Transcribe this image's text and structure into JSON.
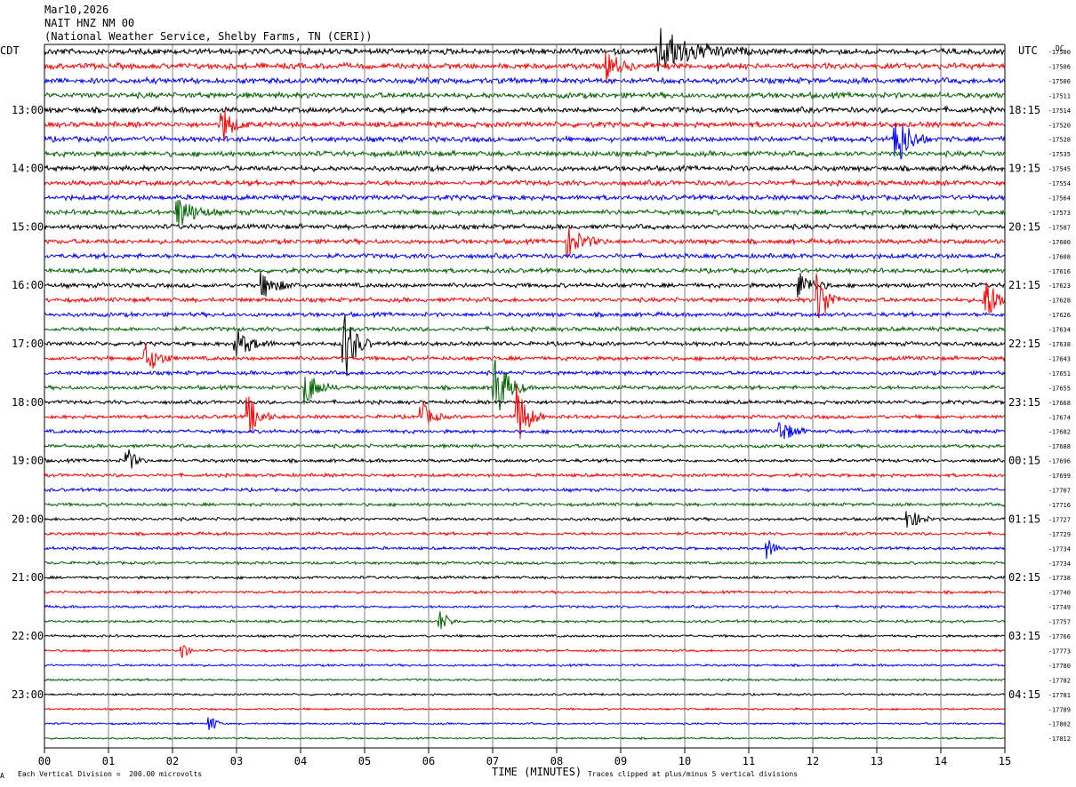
{
  "header": {
    "date": "Mar10,2026",
    "station": "NAIT HNZ NM 00",
    "location": "(National Weather Service, Shelby Farms, TN (CERI))"
  },
  "left_zone": "CDT",
  "right_zone": "UTC",
  "right_unit": "DC",
  "footer": {
    "scale_note": "Each Vertical Division =  200.00 microvolts",
    "clip_note": "Traces clipped at plus/minus 5 vertical divisions",
    "corner_mark": "A"
  },
  "colors": {
    "palette": [
      "#000000",
      "#ff0000",
      "#0000ff",
      "#006400"
    ],
    "grid": "#808080"
  },
  "chart_data": {
    "type": "helicorder",
    "xlabel": "TIME (MINUTES)",
    "x_ticks": [
      "00",
      "01",
      "02",
      "03",
      "04",
      "05",
      "06",
      "07",
      "08",
      "09",
      "10",
      "11",
      "12",
      "13",
      "14",
      "15"
    ],
    "xlim": [
      0,
      15
    ],
    "left_time_labels": [
      "13:00",
      "14:00",
      "15:00",
      "16:00",
      "17:00",
      "18:00",
      "19:00",
      "20:00",
      "21:00",
      "22:00",
      "23:00"
    ],
    "right_time_labels": [
      "18:15",
      "19:15",
      "20:15",
      "21:15",
      "22:15",
      "23:15",
      "00:15",
      "01:15",
      "02:15",
      "03:15",
      "04:15"
    ],
    "trace_offsets": [
      -17500,
      -17506,
      -17506,
      -17511,
      -17514,
      -17520,
      -17528,
      -17535,
      -17545,
      -17554,
      -17564,
      -17573,
      -17587,
      -17600,
      -17608,
      -17616,
      -17623,
      -17628,
      -17626,
      -17634,
      -17638,
      -17643,
      -17651,
      -17655,
      -17668,
      -17674,
      -17682,
      -17688,
      -17696,
      -17699,
      -17707,
      -17716,
      -17727,
      -17729,
      -17734,
      -17734,
      -17738,
      -17740,
      -17749,
      -17757,
      -17766,
      -17773,
      -17780,
      -17782,
      -17781,
      -17789,
      -17802,
      -17812
    ],
    "events": [
      {
        "trace": 0,
        "minute": 9.6,
        "amp": 1.6,
        "dur": 1.4
      },
      {
        "trace": 1,
        "minute": 8.8,
        "amp": 1.0,
        "dur": 0.5
      },
      {
        "trace": 5,
        "minute": 2.8,
        "amp": 1.2,
        "dur": 0.4
      },
      {
        "trace": 6,
        "minute": 13.3,
        "amp": 2.2,
        "dur": 0.5
      },
      {
        "trace": 11,
        "minute": 2.1,
        "amp": 1.2,
        "dur": 0.6
      },
      {
        "trace": 13,
        "minute": 8.2,
        "amp": 1.0,
        "dur": 0.6
      },
      {
        "trace": 16,
        "minute": 3.4,
        "amp": 0.9,
        "dur": 0.6
      },
      {
        "trace": 16,
        "minute": 11.8,
        "amp": 0.9,
        "dur": 0.5
      },
      {
        "trace": 17,
        "minute": 12.1,
        "amp": 1.8,
        "dur": 0.4
      },
      {
        "trace": 17,
        "minute": 14.7,
        "amp": 1.6,
        "dur": 0.5
      },
      {
        "trace": 20,
        "minute": 3.0,
        "amp": 1.0,
        "dur": 0.6
      },
      {
        "trace": 20,
        "minute": 4.7,
        "amp": 2.6,
        "dur": 0.4
      },
      {
        "trace": 21,
        "minute": 1.6,
        "amp": 1.0,
        "dur": 0.5
      },
      {
        "trace": 23,
        "minute": 4.1,
        "amp": 1.2,
        "dur": 0.5
      },
      {
        "trace": 23,
        "minute": 7.05,
        "amp": 2.4,
        "dur": 0.5
      },
      {
        "trace": 25,
        "minute": 3.2,
        "amp": 1.4,
        "dur": 0.4
      },
      {
        "trace": 25,
        "minute": 7.4,
        "amp": 2.2,
        "dur": 0.4
      },
      {
        "trace": 25,
        "minute": 5.9,
        "amp": 1.0,
        "dur": 0.4
      },
      {
        "trace": 26,
        "minute": 11.5,
        "amp": 0.8,
        "dur": 0.5
      },
      {
        "trace": 28,
        "minute": 1.3,
        "amp": 0.9,
        "dur": 0.3
      },
      {
        "trace": 32,
        "minute": 13.5,
        "amp": 0.8,
        "dur": 0.4
      },
      {
        "trace": 34,
        "minute": 11.3,
        "amp": 0.7,
        "dur": 0.3
      },
      {
        "trace": 39,
        "minute": 6.2,
        "amp": 0.7,
        "dur": 0.3
      },
      {
        "trace": 41,
        "minute": 2.15,
        "amp": 0.8,
        "dur": 0.2
      },
      {
        "trace": 46,
        "minute": 2.6,
        "amp": 0.7,
        "dur": 0.2
      }
    ]
  }
}
